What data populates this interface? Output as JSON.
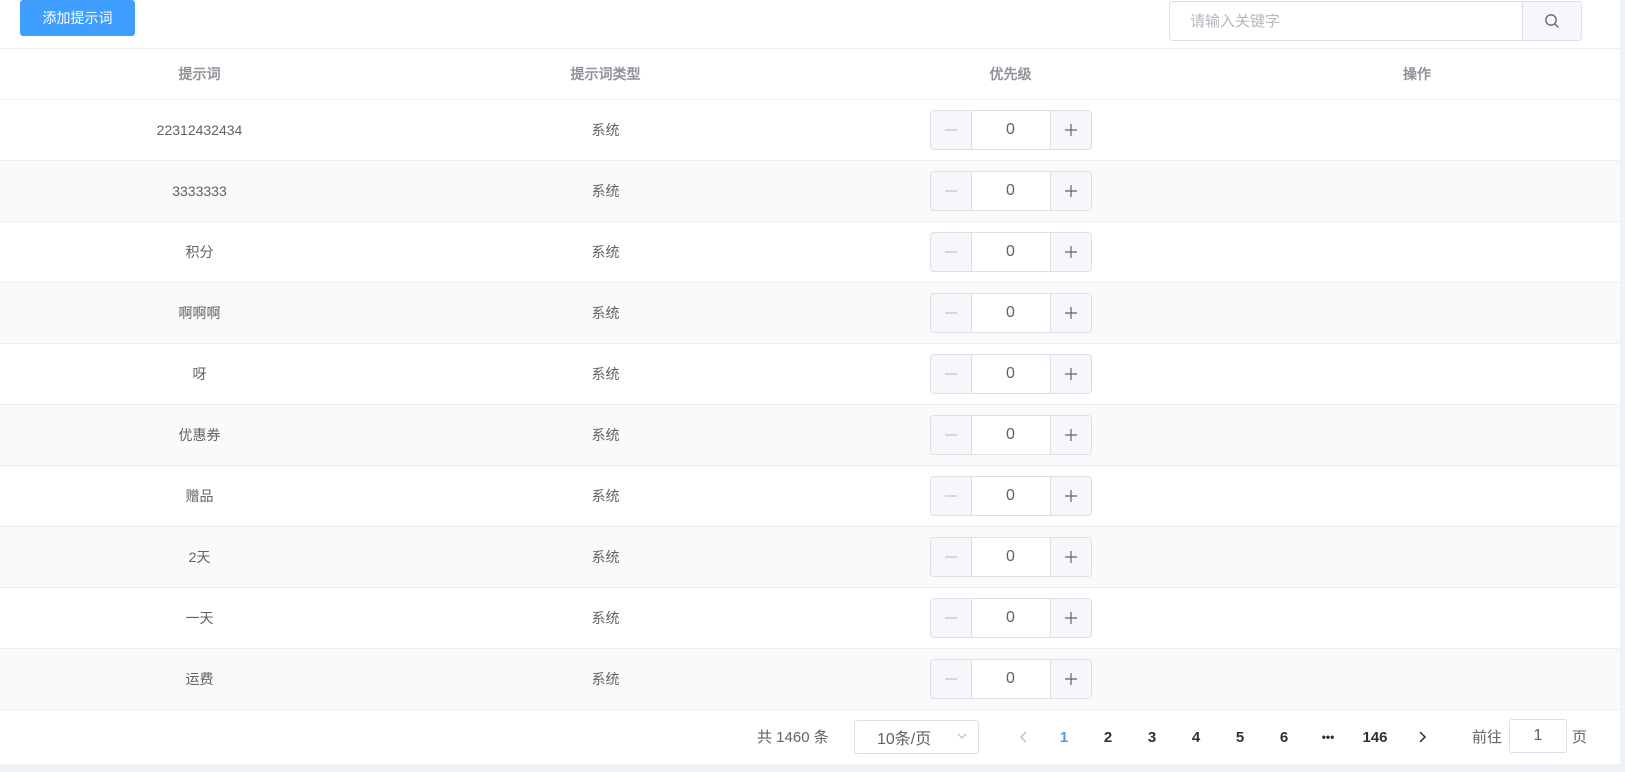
{
  "toolbar": {
    "add_label": "添加提示词",
    "search_placeholder": "请输入关键字"
  },
  "table": {
    "columns": [
      "提示词",
      "提示词类型",
      "优先级",
      "操作"
    ],
    "rows": [
      {
        "keyword": "22312432434",
        "type": "系统",
        "priority": "0"
      },
      {
        "keyword": "3333333",
        "type": "系统",
        "priority": "0"
      },
      {
        "keyword": "积分",
        "type": "系统",
        "priority": "0"
      },
      {
        "keyword": "啊啊啊",
        "type": "系统",
        "priority": "0"
      },
      {
        "keyword": "呀",
        "type": "系统",
        "priority": "0"
      },
      {
        "keyword": "优惠券",
        "type": "系统",
        "priority": "0"
      },
      {
        "keyword": "赠品",
        "type": "系统",
        "priority": "0"
      },
      {
        "keyword": "2天",
        "type": "系统",
        "priority": "0"
      },
      {
        "keyword": "一天",
        "type": "系统",
        "priority": "0"
      },
      {
        "keyword": "运费",
        "type": "系统",
        "priority": "0"
      }
    ]
  },
  "pagination": {
    "total_text": "共 1460 条",
    "page_size": "10条/页",
    "pages": [
      "1",
      "2",
      "3",
      "4",
      "5",
      "6"
    ],
    "ellipsis": "•••",
    "last_page": "146",
    "current_page": "1",
    "goto_prefix": "前往",
    "goto_value": "1",
    "goto_suffix": "页"
  },
  "colors": {
    "primary": "#409eff",
    "text": "#606266",
    "header_text": "#909399",
    "border": "#ebeef5"
  },
  "icons": {
    "search": "search-icon",
    "minus": "minus-icon",
    "plus": "plus-icon",
    "prev": "chevron-left-icon",
    "next": "chevron-right-icon",
    "select": "chevron-down-icon"
  }
}
